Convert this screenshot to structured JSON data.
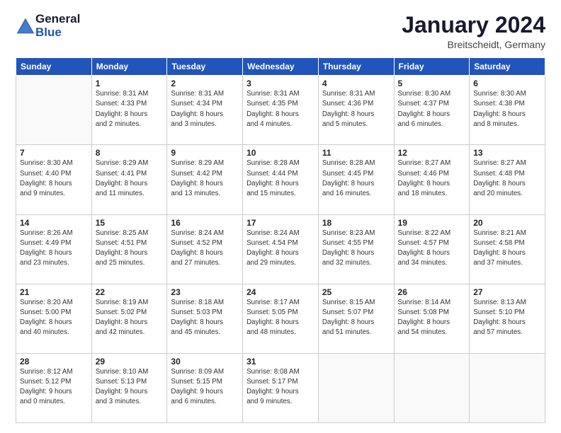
{
  "logo": {
    "general": "General",
    "blue": "Blue"
  },
  "title": "January 2024",
  "location": "Breitscheidt, Germany",
  "days_of_week": [
    "Sunday",
    "Monday",
    "Tuesday",
    "Wednesday",
    "Thursday",
    "Friday",
    "Saturday"
  ],
  "weeks": [
    [
      {
        "day": "",
        "info": ""
      },
      {
        "day": "1",
        "info": "Sunrise: 8:31 AM\nSunset: 4:33 PM\nDaylight: 8 hours\nand 2 minutes."
      },
      {
        "day": "2",
        "info": "Sunrise: 8:31 AM\nSunset: 4:34 PM\nDaylight: 8 hours\nand 3 minutes."
      },
      {
        "day": "3",
        "info": "Sunrise: 8:31 AM\nSunset: 4:35 PM\nDaylight: 8 hours\nand 4 minutes."
      },
      {
        "day": "4",
        "info": "Sunrise: 8:31 AM\nSunset: 4:36 PM\nDaylight: 8 hours\nand 5 minutes."
      },
      {
        "day": "5",
        "info": "Sunrise: 8:30 AM\nSunset: 4:37 PM\nDaylight: 8 hours\nand 6 minutes."
      },
      {
        "day": "6",
        "info": "Sunrise: 8:30 AM\nSunset: 4:38 PM\nDaylight: 8 hours\nand 8 minutes."
      }
    ],
    [
      {
        "day": "7",
        "info": "Sunrise: 8:30 AM\nSunset: 4:40 PM\nDaylight: 8 hours\nand 9 minutes."
      },
      {
        "day": "8",
        "info": "Sunrise: 8:29 AM\nSunset: 4:41 PM\nDaylight: 8 hours\nand 11 minutes."
      },
      {
        "day": "9",
        "info": "Sunrise: 8:29 AM\nSunset: 4:42 PM\nDaylight: 8 hours\nand 13 minutes."
      },
      {
        "day": "10",
        "info": "Sunrise: 8:28 AM\nSunset: 4:44 PM\nDaylight: 8 hours\nand 15 minutes."
      },
      {
        "day": "11",
        "info": "Sunrise: 8:28 AM\nSunset: 4:45 PM\nDaylight: 8 hours\nand 16 minutes."
      },
      {
        "day": "12",
        "info": "Sunrise: 8:27 AM\nSunset: 4:46 PM\nDaylight: 8 hours\nand 18 minutes."
      },
      {
        "day": "13",
        "info": "Sunrise: 8:27 AM\nSunset: 4:48 PM\nDaylight: 8 hours\nand 20 minutes."
      }
    ],
    [
      {
        "day": "14",
        "info": "Sunrise: 8:26 AM\nSunset: 4:49 PM\nDaylight: 8 hours\nand 23 minutes."
      },
      {
        "day": "15",
        "info": "Sunrise: 8:25 AM\nSunset: 4:51 PM\nDaylight: 8 hours\nand 25 minutes."
      },
      {
        "day": "16",
        "info": "Sunrise: 8:24 AM\nSunset: 4:52 PM\nDaylight: 8 hours\nand 27 minutes."
      },
      {
        "day": "17",
        "info": "Sunrise: 8:24 AM\nSunset: 4:54 PM\nDaylight: 8 hours\nand 29 minutes."
      },
      {
        "day": "18",
        "info": "Sunrise: 8:23 AM\nSunset: 4:55 PM\nDaylight: 8 hours\nand 32 minutes."
      },
      {
        "day": "19",
        "info": "Sunrise: 8:22 AM\nSunset: 4:57 PM\nDaylight: 8 hours\nand 34 minutes."
      },
      {
        "day": "20",
        "info": "Sunrise: 8:21 AM\nSunset: 4:58 PM\nDaylight: 8 hours\nand 37 minutes."
      }
    ],
    [
      {
        "day": "21",
        "info": "Sunrise: 8:20 AM\nSunset: 5:00 PM\nDaylight: 8 hours\nand 40 minutes."
      },
      {
        "day": "22",
        "info": "Sunrise: 8:19 AM\nSunset: 5:02 PM\nDaylight: 8 hours\nand 42 minutes."
      },
      {
        "day": "23",
        "info": "Sunrise: 8:18 AM\nSunset: 5:03 PM\nDaylight: 8 hours\nand 45 minutes."
      },
      {
        "day": "24",
        "info": "Sunrise: 8:17 AM\nSunset: 5:05 PM\nDaylight: 8 hours\nand 48 minutes."
      },
      {
        "day": "25",
        "info": "Sunrise: 8:15 AM\nSunset: 5:07 PM\nDaylight: 8 hours\nand 51 minutes."
      },
      {
        "day": "26",
        "info": "Sunrise: 8:14 AM\nSunset: 5:08 PM\nDaylight: 8 hours\nand 54 minutes."
      },
      {
        "day": "27",
        "info": "Sunrise: 8:13 AM\nSunset: 5:10 PM\nDaylight: 8 hours\nand 57 minutes."
      }
    ],
    [
      {
        "day": "28",
        "info": "Sunrise: 8:12 AM\nSunset: 5:12 PM\nDaylight: 9 hours\nand 0 minutes."
      },
      {
        "day": "29",
        "info": "Sunrise: 8:10 AM\nSunset: 5:13 PM\nDaylight: 9 hours\nand 3 minutes."
      },
      {
        "day": "30",
        "info": "Sunrise: 8:09 AM\nSunset: 5:15 PM\nDaylight: 9 hours\nand 6 minutes."
      },
      {
        "day": "31",
        "info": "Sunrise: 8:08 AM\nSunset: 5:17 PM\nDaylight: 9 hours\nand 9 minutes."
      },
      {
        "day": "",
        "info": ""
      },
      {
        "day": "",
        "info": ""
      },
      {
        "day": "",
        "info": ""
      }
    ]
  ]
}
